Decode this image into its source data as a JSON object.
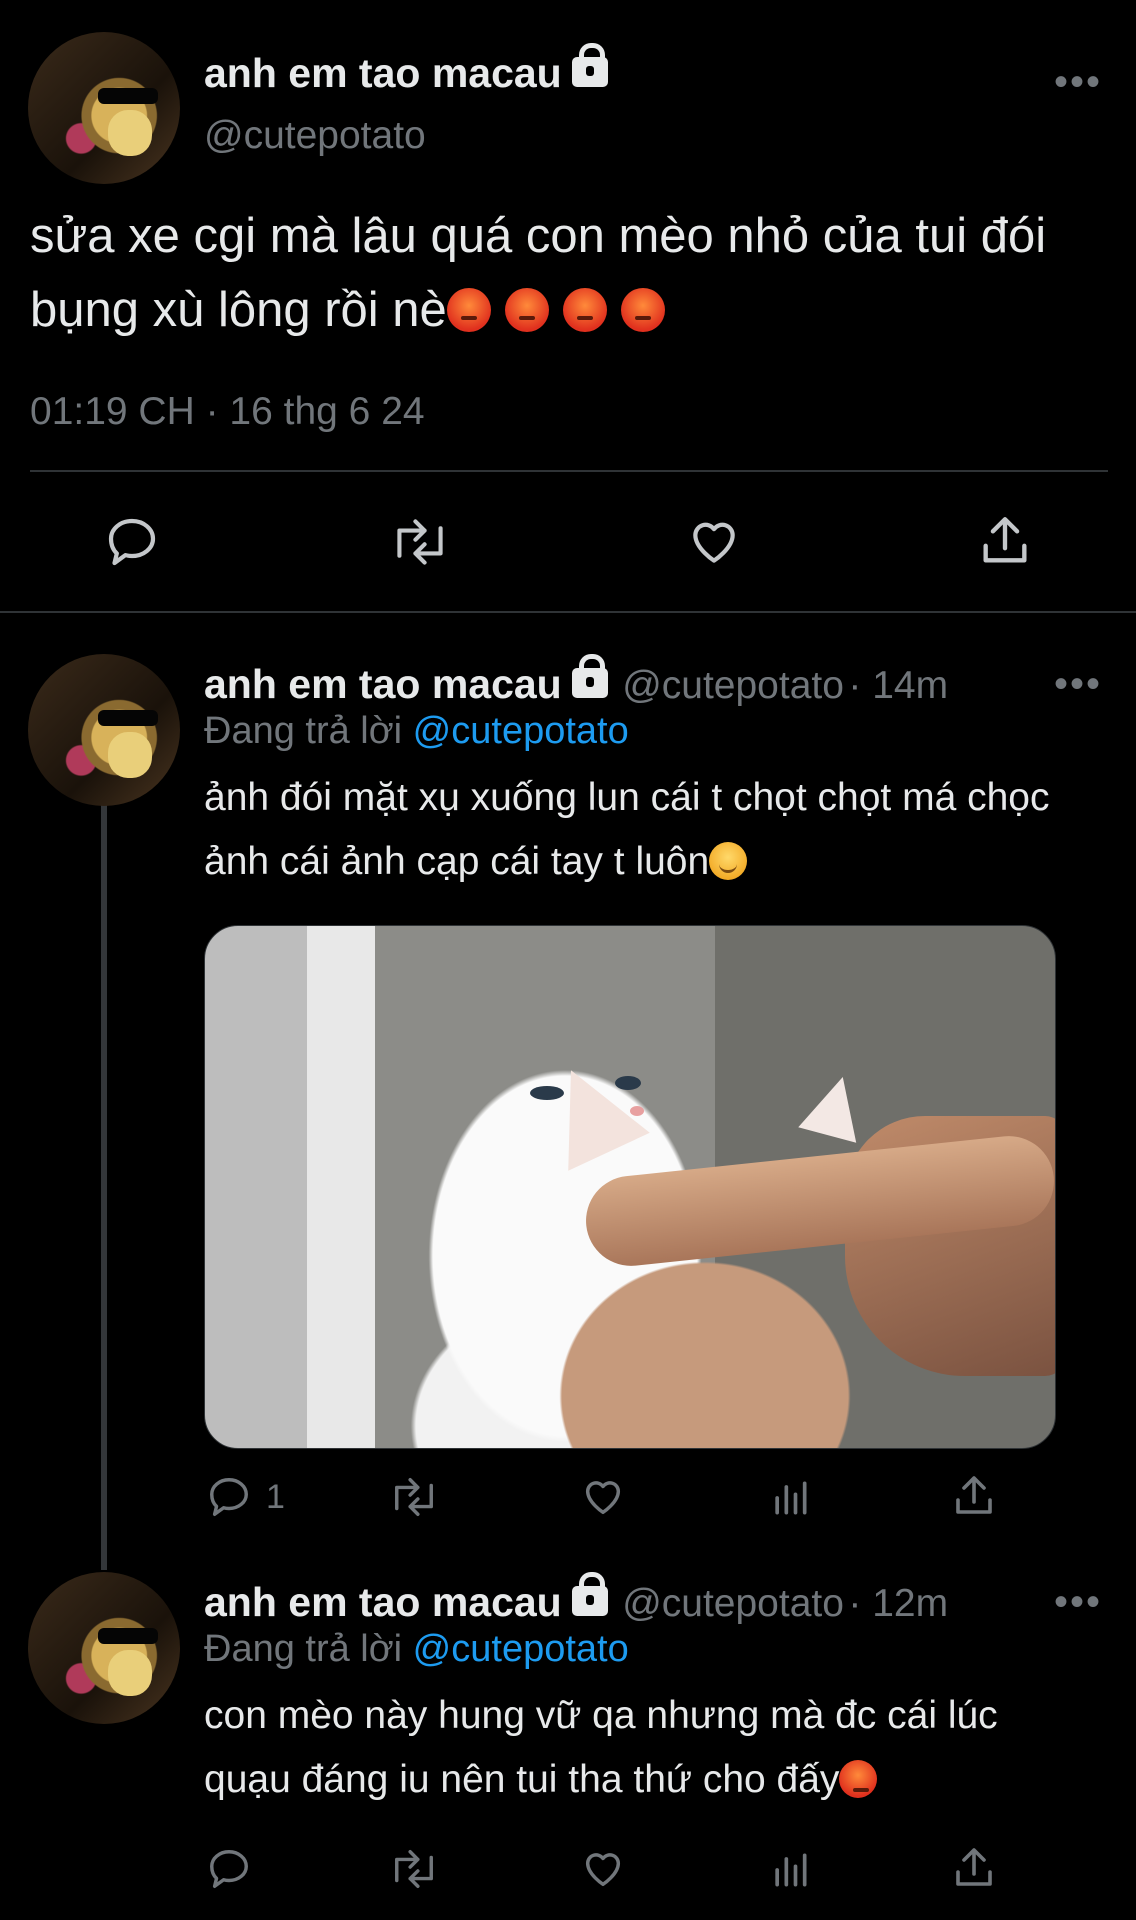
{
  "main_tweet": {
    "display_name": "anh em tao macau",
    "handle": "@cutepotato",
    "text": "sửa xe cgi mà lâu quá con mèo nhỏ của tui đói bụng xù lông rồi nè",
    "emoji_count": 4,
    "timestamp": "01:19 CH · 16 thg 6 24"
  },
  "replies": [
    {
      "display_name": "anh em tao macau",
      "handle": "@cutepotato",
      "time": "· 14m",
      "replying_label": "Đang trả lời",
      "replying_to": "@cutepotato",
      "text": "ảnh đói mặt xụ xuống lun cái t chọt chọt má chọc ảnh cái ảnh cạp cái tay t luôn",
      "reply_count": "1"
    },
    {
      "display_name": "anh em tao macau",
      "handle": "@cutepotato",
      "time": "· 12m",
      "replying_label": "Đang trả lời",
      "replying_to": "@cutepotato",
      "text": "con mèo này hung vữ qa nhưng mà đc cái lúc quạu đáng iu nên tui tha thứ cho đấy",
      "reply_count": ""
    }
  ],
  "icons": {
    "reply": "reply-icon",
    "retweet": "retweet-icon",
    "like": "heart-icon",
    "views": "views-icon",
    "share": "share-icon",
    "more": "more-icon",
    "lock": "lock-icon"
  },
  "colors": {
    "background": "#000000",
    "text": "#e7e9ea",
    "secondary": "#71767b",
    "link": "#1d9bf0",
    "divider": "#2f3336"
  }
}
